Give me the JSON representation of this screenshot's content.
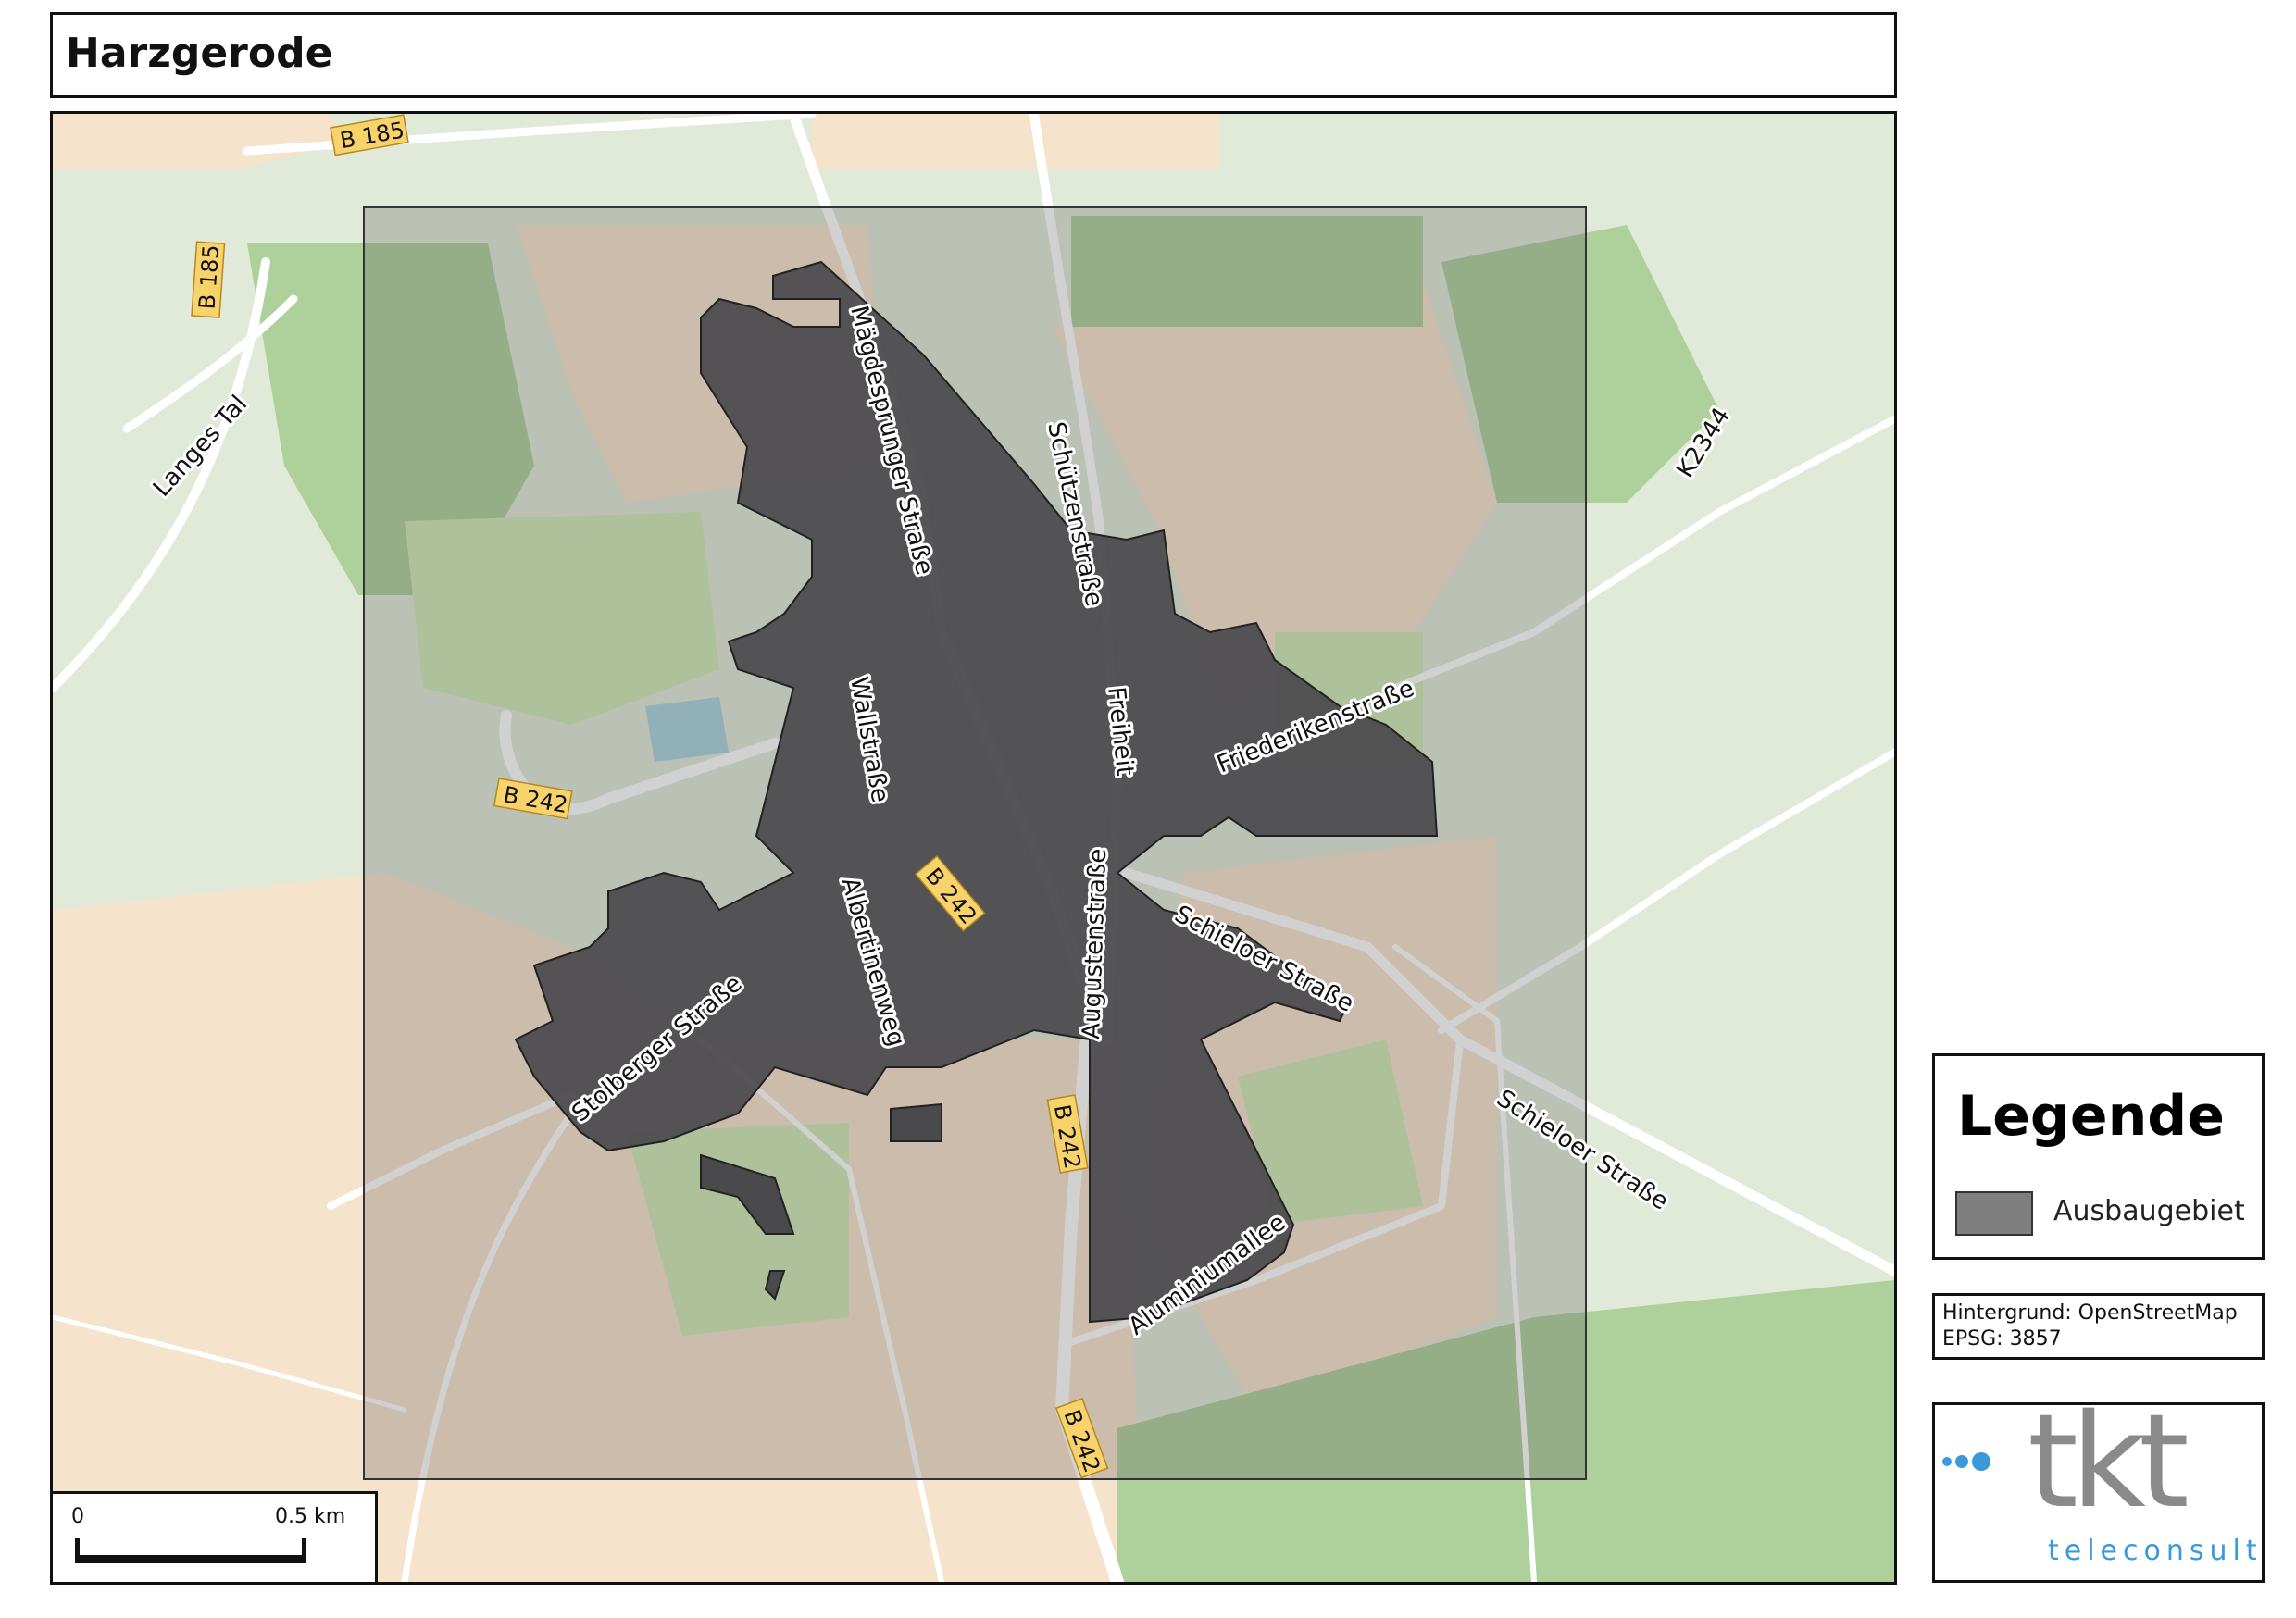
{
  "title": "Harzgerode",
  "map": {
    "colors": {
      "farmland": "#f6e3cb",
      "meadow": "#cfeab5",
      "forest": "#aed19c",
      "background": "#e1ead9",
      "area_fill": "#4a494c",
      "road": "#ffffff",
      "shield": "#f8d26b",
      "water": "#aad3df"
    },
    "road_labels": {
      "langes_tal": "Langes Tal",
      "maegdesprunger": "Mägdesprunger Straße",
      "schuetzenstrasse": "Schützenstraße",
      "k2344": "K2344",
      "wallstrasse": "Wallstraße",
      "freiheit": "Freiheit",
      "friederikenstrasse": "Friederikenstraße",
      "albertinenweg": "Albertinenweg",
      "augustenstrasse": "Augustenstraße",
      "schieloer_1": "Schieloer Straße",
      "schieloer_2": "Schieloer Straße",
      "stolberger": "Stolberger Straße",
      "aluminiumallee": "Aluminiumallee"
    },
    "shields": {
      "b185_top": "B 185",
      "b185_left": "B 185",
      "b242_west": "B 242",
      "b242_center": "B 242",
      "b242_south1": "B 242",
      "b242_south2": "B 242"
    },
    "scale": {
      "start": "0",
      "end": "0.5 km"
    }
  },
  "legend": {
    "title": "Legende",
    "item_label": "Ausbaugebiet"
  },
  "source": {
    "line1": "Hintergrund: OpenStreetMap",
    "line2": "EPSG: 3857"
  },
  "logo": {
    "text": "tkt",
    "subtext": "teleconsult"
  }
}
